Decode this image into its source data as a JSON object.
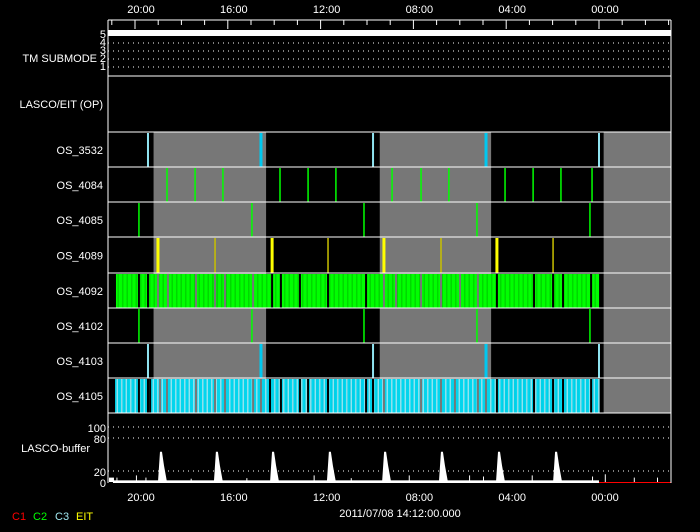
{
  "chart_data": {
    "type": "timeline",
    "date_label": "2011/07/08 14:12:00.000",
    "x_axis": {
      "unit": "hour-of-day (descending to the right, previous day below 0)",
      "range": [
        21.16,
        -3.1
      ],
      "ticks": [
        {
          "value": 20,
          "label": "20:00"
        },
        {
          "value": 16,
          "label": "16:00"
        },
        {
          "value": 12,
          "label": "12:00"
        },
        {
          "value": 8,
          "label": "08:00"
        },
        {
          "value": 4,
          "label": "04:00"
        },
        {
          "value": 0,
          "label": "00:00"
        }
      ]
    },
    "tm_submode": {
      "label": "TM SUBMODE",
      "levels": [
        "5",
        "4",
        "3",
        "2",
        "1"
      ],
      "value": 5
    },
    "lasco_eit": {
      "label": "LASCO/EIT (OP)"
    },
    "gray_intervals": [
      [
        19.2,
        14.35
      ],
      [
        9.45,
        4.65
      ],
      [
        -0.2,
        -3.1
      ]
    ],
    "rows": [
      {
        "label": "OS_3532",
        "marks": [
          {
            "t": 19.44,
            "c": "#8fe3f0"
          },
          {
            "t": 14.57,
            "c": "#00c8f0"
          },
          {
            "t": 9.74,
            "c": "#8fe3f0"
          },
          {
            "t": 4.87,
            "c": "#00c8f0"
          },
          {
            "t": 0.0,
            "c": "#8fe3f0"
          }
        ]
      },
      {
        "label": "OS_4084",
        "marks": [
          {
            "t": 18.62,
            "c": "#00ff00"
          },
          {
            "t": 17.41,
            "c": "#00ff00"
          },
          {
            "t": 16.21,
            "c": "#00ff00"
          },
          {
            "t": 13.75,
            "c": "#00ff00"
          },
          {
            "t": 12.54,
            "c": "#00ff00"
          },
          {
            "t": 11.34,
            "c": "#00ff00"
          },
          {
            "t": 8.92,
            "c": "#00ff00"
          },
          {
            "t": 7.67,
            "c": "#00ff00"
          },
          {
            "t": 6.47,
            "c": "#00ff00"
          },
          {
            "t": 4.05,
            "c": "#00ff00"
          },
          {
            "t": 2.84,
            "c": "#00ff00"
          },
          {
            "t": 1.64,
            "c": "#00ff00"
          },
          {
            "t": 0.3,
            "c": "#00ff00"
          }
        ]
      },
      {
        "label": "OS_4085",
        "marks": [
          {
            "t": 19.83,
            "c": "#00ff00"
          },
          {
            "t": 14.96,
            "c": "#00ff00"
          },
          {
            "t": 10.13,
            "c": "#00ff00"
          },
          {
            "t": 5.26,
            "c": "#00ff00"
          },
          {
            "t": 0.39,
            "c": "#00ff00"
          }
        ]
      },
      {
        "label": "OS_4089",
        "marks": [
          {
            "t": 19.01,
            "c": "#ffff00"
          },
          {
            "t": 16.55,
            "c": "#c8c000"
          },
          {
            "t": 14.09,
            "c": "#ffff00"
          },
          {
            "t": 11.68,
            "c": "#c8c000"
          },
          {
            "t": 9.27,
            "c": "#ffff00"
          },
          {
            "t": 6.81,
            "c": "#c8c000"
          },
          {
            "t": 4.4,
            "c": "#ffff00"
          },
          {
            "t": 1.98,
            "c": "#c8c000"
          }
        ]
      },
      {
        "label": "OS_4092",
        "fill": {
          "from": 20.82,
          "to": 0.04,
          "c1": "#00ff00",
          "c2": "#00d800"
        },
        "gaps": [
          19.83,
          19.44,
          19.01,
          18.58,
          17.37,
          16.55,
          16.12,
          14.91,
          14.09,
          13.71,
          12.89,
          11.68,
          10.04,
          9.27,
          8.75,
          7.67,
          6.81,
          5.99,
          5.22,
          4.4,
          2.8,
          1.98,
          1.55,
          0.34
        ]
      },
      {
        "label": "OS_4102",
        "marks": [
          {
            "t": 19.83,
            "c": "#00ff00"
          },
          {
            "t": 14.96,
            "c": "#00ff00"
          },
          {
            "t": 10.13,
            "c": "#00ff00"
          },
          {
            "t": 5.26,
            "c": "#00ff00"
          },
          {
            "t": 0.39,
            "c": "#00ff00"
          }
        ]
      },
      {
        "label": "OS_4103",
        "marks": [
          {
            "t": 19.44,
            "c": "#8fe3f0"
          },
          {
            "t": 14.57,
            "c": "#00c8f0"
          },
          {
            "t": 9.74,
            "c": "#8fe3f0"
          },
          {
            "t": 4.87,
            "c": "#00c8f0"
          },
          {
            "t": 0.0,
            "c": "#8fe3f0"
          }
        ]
      },
      {
        "label": "OS_4105",
        "fill": {
          "from": 20.86,
          "to": 0.04,
          "c1": "#00d8f0",
          "c2": "#90e4f0"
        },
        "gaps": [
          19.83,
          19.44,
          19.35,
          18.92,
          18.62,
          17.37,
          16.55,
          16.12,
          14.91,
          14.57,
          14.18,
          13.71,
          12.89,
          12.54,
          11.68,
          10.04,
          9.74,
          9.27,
          7.67,
          6.81,
          6.21,
          5.22,
          4.87,
          4.4,
          2.8,
          1.98,
          1.55,
          0.34
        ]
      }
    ],
    "buffer": {
      "label": "LASCO-buffer",
      "y_ticks": [
        100,
        80,
        20,
        0
      ],
      "ylim": [
        0,
        100
      ],
      "baseline": 3,
      "baseline_end": 0.0,
      "peaks": [
        18.88,
        16.47,
        14.05,
        11.6,
        9.22,
        6.77,
        4.31,
        1.85
      ],
      "peak_value": 55,
      "spikes": [
        {
          "t": 20.8,
          "v": 8
        },
        {
          "t": 19.96,
          "v": 12
        },
        {
          "t": 19.55,
          "v": 8
        },
        {
          "t": 17.6,
          "v": 6
        },
        {
          "t": 15.2,
          "v": 7
        },
        {
          "t": 12.3,
          "v": 12
        },
        {
          "t": 10.7,
          "v": 7
        },
        {
          "t": 8.2,
          "v": 12
        },
        {
          "t": 5.6,
          "v": 12
        },
        {
          "t": 5.0,
          "v": 10
        },
        {
          "t": 2.9,
          "v": 12
        },
        {
          "t": 0.3,
          "v": 10
        },
        {
          "t": -0.25,
          "v": 14
        },
        {
          "t": -1.5,
          "v": 8
        },
        {
          "t": -2.5,
          "v": 8
        }
      ]
    },
    "legend": [
      {
        "label": "C1",
        "color": "#ff0000"
      },
      {
        "label": "C2",
        "color": "#00ff00"
      },
      {
        "label": "C3",
        "color": "#a0e8f0"
      },
      {
        "label": "EIT",
        "color": "#ffff00"
      }
    ]
  }
}
